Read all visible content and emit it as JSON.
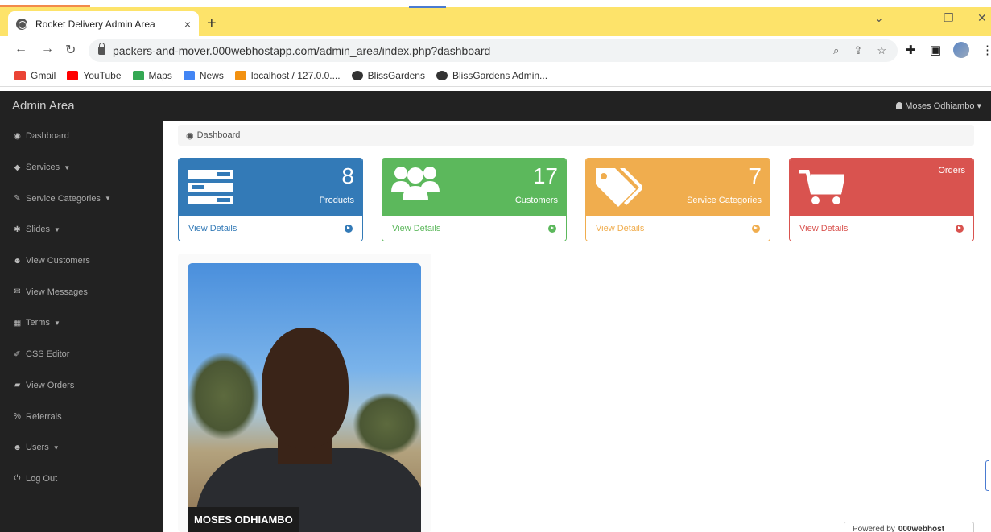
{
  "browser": {
    "tab_title": "Rocket Delivery Admin Area",
    "tab_close": "×",
    "new_tab": "+",
    "url": "packers-and-mover.000webhostapp.com/admin_area/index.php?dashboard",
    "bookmarks": [
      {
        "label": "Gmail",
        "icon": "gmail-icon",
        "color": "#ea4335"
      },
      {
        "label": "YouTube",
        "icon": "youtube-icon",
        "color": "#ff0000"
      },
      {
        "label": "Maps",
        "icon": "maps-icon",
        "color": "#34a853"
      },
      {
        "label": "News",
        "icon": "news-icon",
        "color": "#4285f4"
      },
      {
        "label": "localhost / 127.0.0....",
        "icon": "phpmyadmin-icon",
        "color": "#f29111"
      },
      {
        "label": "BlissGardens",
        "icon": "globe-icon",
        "color": "#333333"
      },
      {
        "label": "BlissGardens Admin...",
        "icon": "globe-icon",
        "color": "#333333"
      }
    ]
  },
  "app": {
    "brand": "Admin Area",
    "user": "Moses Odhiambo",
    "breadcrumb": "Dashboard",
    "sidebar": [
      {
        "label": "Dashboard",
        "icon": "dashboard-icon",
        "glyph": "◉",
        "dropdown": false
      },
      {
        "label": "Services",
        "icon": "tag-icon",
        "glyph": "◆",
        "dropdown": true
      },
      {
        "label": "Service Categories",
        "icon": "edit-icon",
        "glyph": "✎",
        "dropdown": true
      },
      {
        "label": "Slides",
        "icon": "gear-icon",
        "glyph": "✱",
        "dropdown": true
      },
      {
        "label": "View Customers",
        "icon": "users-icon",
        "glyph": "☻",
        "dropdown": false
      },
      {
        "label": "View Messages",
        "icon": "envelope-icon",
        "glyph": "✉",
        "dropdown": false
      },
      {
        "label": "Terms",
        "icon": "table-icon",
        "glyph": "▦",
        "dropdown": true
      },
      {
        "label": "CSS Editor",
        "icon": "pencil-icon",
        "glyph": "✐",
        "dropdown": false
      },
      {
        "label": "View Orders",
        "icon": "book-icon",
        "glyph": "▰",
        "dropdown": false
      },
      {
        "label": "Referrals",
        "icon": "percent-icon",
        "glyph": "%",
        "dropdown": false
      },
      {
        "label": "Users",
        "icon": "users-icon",
        "glyph": "☻",
        "dropdown": true
      },
      {
        "label": "Log Out",
        "icon": "power-icon",
        "glyph": "⏻",
        "dropdown": false
      }
    ],
    "panels": [
      {
        "count": "8",
        "label": "Products",
        "link": "View Details",
        "color": "#337ab7",
        "icon": "list-icon"
      },
      {
        "count": "17",
        "label": "Customers",
        "link": "View Details",
        "color": "#5cb85c",
        "icon": "users-icon"
      },
      {
        "count": "7",
        "label": "Service Categories",
        "link": "View Details",
        "color": "#f0ad4e",
        "icon": "tags-icon"
      },
      {
        "count": "",
        "label": "Orders",
        "link": "View Details",
        "color": "#d9534f",
        "icon": "cart-icon"
      }
    ],
    "profile_name": "MOSES ODHIAMBO",
    "powered_by": "Powered by",
    "powered_brand": "000webhost"
  }
}
